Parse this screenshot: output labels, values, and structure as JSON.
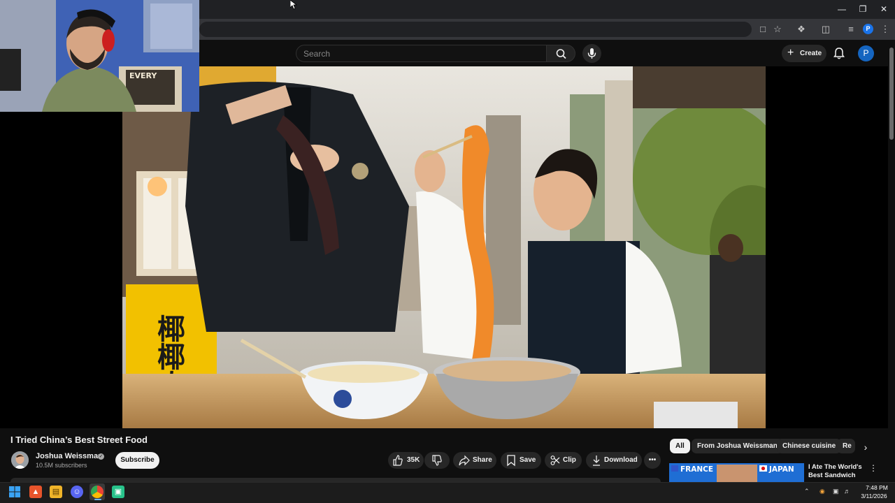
{
  "header": {
    "search_placeholder": "Search",
    "create_label": "Create",
    "avatar_letter": "P",
    "profile_letter": "P"
  },
  "video": {
    "title": "I Tried China’s Best Street Food",
    "channel": "Joshua Weissman",
    "verified_mark": "✓",
    "subscribers": "10.5M subscribers",
    "subscribe_label": "Subscribe",
    "likes": "35K",
    "share_label": "Share",
    "save_label": "Save",
    "clip_label": "Clip",
    "download_label": "Download",
    "sign_text_1": "椰",
    "sign_text_2": "椰",
    "sign_text_3": "肉"
  },
  "chips": [
    "All",
    "From Joshua Weissman",
    "Chinese cuisine",
    "Re"
  ],
  "recommendation": {
    "title": "I Ate The World's Best Sandwich",
    "thumb_left": "FRANCE",
    "thumb_right": "JAPAN"
  },
  "taskbar": {
    "time": "7:48 PM",
    "date": "3/11/2026"
  },
  "colors": {
    "accent": "#1a73e8",
    "background": "#0f0f0f",
    "pill": "#272727"
  }
}
